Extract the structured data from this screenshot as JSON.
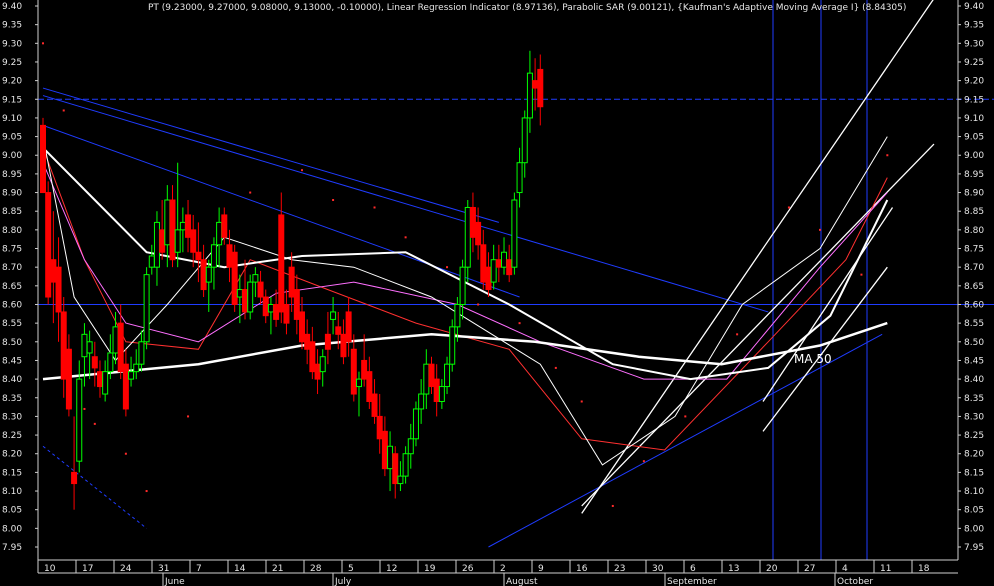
{
  "chart_data": {
    "type": "candlestick",
    "title": "PT (9.23000, 9.27000, 9.08000, 9.13000, -0.10000), Linear Regression Indicator (8.97136), Parabolic SAR (9.00121), {Kaufman's Adaptive Moving Average I} (8.84305)",
    "annotation": "MA 50",
    "ylim": [
      7.95,
      9.42
    ],
    "yticks": [
      "9.40",
      "9.35",
      "9.30",
      "9.25",
      "9.20",
      "9.15",
      "9.10",
      "9.05",
      "9.00",
      "8.95",
      "8.90",
      "8.85",
      "8.80",
      "8.75",
      "8.70",
      "8.65",
      "8.60",
      "8.55",
      "8.50",
      "8.45",
      "8.40",
      "8.35",
      "8.30",
      "8.25",
      "8.20",
      "8.15",
      "8.10",
      "8.05",
      "8.00",
      "7.95"
    ],
    "xticks_top": [
      "10",
      "17",
      "24",
      "31",
      "7",
      "14",
      "21",
      "28",
      "5",
      "12",
      "19",
      "26",
      "2",
      "9",
      "16",
      "23",
      "30",
      "6",
      "13",
      "20",
      "27",
      "4",
      "11",
      "18"
    ],
    "months": [
      "June",
      "July",
      "August",
      "September",
      "October"
    ],
    "horizontal_lines": [
      9.15,
      8.6
    ],
    "colors": {
      "up": "#00ff00",
      "down": "#ff0000",
      "trendline": "#1f3cff",
      "channel": "#ffffff",
      "ma50": "#ffffff",
      "ma_mid": "#ffffff",
      "ma_a": "#ff3030",
      "ma_b": "#ff6fff",
      "sar": "#ff2a2a"
    },
    "candles": [
      {
        "o": 9.08,
        "h": 9.1,
        "l": 8.95,
        "c": 8.9
      },
      {
        "o": 8.9,
        "h": 8.93,
        "l": 8.6,
        "c": 8.62
      },
      {
        "o": 8.72,
        "h": 8.85,
        "l": 8.55,
        "c": 8.66
      },
      {
        "o": 8.7,
        "h": 8.78,
        "l": 8.5,
        "c": 8.58
      },
      {
        "o": 8.58,
        "h": 8.62,
        "l": 8.35,
        "c": 8.4
      },
      {
        "o": 8.48,
        "h": 8.52,
        "l": 8.3,
        "c": 8.32
      },
      {
        "o": 8.15,
        "h": 8.3,
        "l": 8.05,
        "c": 8.12
      },
      {
        "o": 8.18,
        "h": 8.45,
        "l": 8.15,
        "c": 8.4
      },
      {
        "o": 8.46,
        "h": 8.55,
        "l": 8.38,
        "c": 8.52
      },
      {
        "o": 8.47,
        "h": 8.53,
        "l": 8.4,
        "c": 8.5
      },
      {
        "o": 8.46,
        "h": 8.5,
        "l": 8.38,
        "c": 8.43
      },
      {
        "o": 8.42,
        "h": 8.45,
        "l": 8.35,
        "c": 8.38
      },
      {
        "o": 8.36,
        "h": 8.45,
        "l": 8.34,
        "c": 8.42
      },
      {
        "o": 8.42,
        "h": 8.52,
        "l": 8.4,
        "c": 8.47
      },
      {
        "o": 8.47,
        "h": 8.58,
        "l": 8.44,
        "c": 8.54
      },
      {
        "o": 8.55,
        "h": 8.6,
        "l": 8.4,
        "c": 8.42
      },
      {
        "o": 8.44,
        "h": 8.48,
        "l": 8.3,
        "c": 8.32
      },
      {
        "o": 8.4,
        "h": 8.46,
        "l": 8.38,
        "c": 8.42
      },
      {
        "o": 8.42,
        "h": 8.48,
        "l": 8.4,
        "c": 8.44
      },
      {
        "o": 8.44,
        "h": 8.53,
        "l": 8.42,
        "c": 8.5
      },
      {
        "o": 8.5,
        "h": 8.7,
        "l": 8.48,
        "c": 8.68
      },
      {
        "o": 8.7,
        "h": 8.76,
        "l": 8.68,
        "c": 8.73
      },
      {
        "o": 8.7,
        "h": 8.85,
        "l": 8.65,
        "c": 8.82
      },
      {
        "o": 8.8,
        "h": 8.88,
        "l": 8.72,
        "c": 8.74
      },
      {
        "o": 8.76,
        "h": 8.92,
        "l": 8.7,
        "c": 8.88
      },
      {
        "o": 8.88,
        "h": 8.92,
        "l": 8.7,
        "c": 8.72
      },
      {
        "o": 8.74,
        "h": 8.98,
        "l": 8.7,
        "c": 8.8
      },
      {
        "o": 8.8,
        "h": 8.86,
        "l": 8.74,
        "c": 8.82
      },
      {
        "o": 8.84,
        "h": 8.88,
        "l": 8.74,
        "c": 8.78
      },
      {
        "o": 8.8,
        "h": 8.84,
        "l": 8.7,
        "c": 8.74
      },
      {
        "o": 8.74,
        "h": 8.82,
        "l": 8.66,
        "c": 8.72
      },
      {
        "o": 8.72,
        "h": 8.76,
        "l": 8.62,
        "c": 8.64
      },
      {
        "o": 8.66,
        "h": 8.72,
        "l": 8.58,
        "c": 8.7
      },
      {
        "o": 8.7,
        "h": 8.78,
        "l": 8.64,
        "c": 8.76
      },
      {
        "o": 8.76,
        "h": 8.86,
        "l": 8.7,
        "c": 8.82
      },
      {
        "o": 8.84,
        "h": 8.86,
        "l": 8.76,
        "c": 8.78
      },
      {
        "o": 8.76,
        "h": 8.8,
        "l": 8.66,
        "c": 8.7
      },
      {
        "o": 8.74,
        "h": 8.76,
        "l": 8.58,
        "c": 8.6
      },
      {
        "o": 8.62,
        "h": 8.68,
        "l": 8.55,
        "c": 8.64
      },
      {
        "o": 8.64,
        "h": 8.72,
        "l": 8.56,
        "c": 8.58
      },
      {
        "o": 8.58,
        "h": 8.68,
        "l": 8.56,
        "c": 8.66
      },
      {
        "o": 8.66,
        "h": 8.7,
        "l": 8.62,
        "c": 8.68
      },
      {
        "o": 8.66,
        "h": 8.69,
        "l": 8.6,
        "c": 8.62
      },
      {
        "o": 8.62,
        "h": 8.64,
        "l": 8.55,
        "c": 8.57
      },
      {
        "o": 8.58,
        "h": 8.62,
        "l": 8.52,
        "c": 8.6
      },
      {
        "o": 8.6,
        "h": 8.64,
        "l": 8.54,
        "c": 8.56
      },
      {
        "o": 8.84,
        "h": 8.9,
        "l": 8.55,
        "c": 8.58
      },
      {
        "o": 8.6,
        "h": 8.64,
        "l": 8.52,
        "c": 8.55
      },
      {
        "o": 8.7,
        "h": 8.74,
        "l": 8.58,
        "c": 8.62
      },
      {
        "o": 8.64,
        "h": 8.68,
        "l": 8.52,
        "c": 8.56
      },
      {
        "o": 8.58,
        "h": 8.62,
        "l": 8.48,
        "c": 8.5
      },
      {
        "o": 8.52,
        "h": 8.56,
        "l": 8.44,
        "c": 8.48
      },
      {
        "o": 8.5,
        "h": 8.54,
        "l": 8.4,
        "c": 8.42
      },
      {
        "o": 8.44,
        "h": 8.48,
        "l": 8.36,
        "c": 8.4
      },
      {
        "o": 8.42,
        "h": 8.48,
        "l": 8.38,
        "c": 8.46
      },
      {
        "o": 8.52,
        "h": 8.58,
        "l": 8.44,
        "c": 8.48
      },
      {
        "o": 8.56,
        "h": 8.62,
        "l": 8.52,
        "c": 8.58
      },
      {
        "o": 8.54,
        "h": 8.58,
        "l": 8.48,
        "c": 8.52
      },
      {
        "o": 8.52,
        "h": 8.56,
        "l": 8.44,
        "c": 8.46
      },
      {
        "o": 8.58,
        "h": 8.62,
        "l": 8.46,
        "c": 8.5
      },
      {
        "o": 8.48,
        "h": 8.52,
        "l": 8.34,
        "c": 8.36
      },
      {
        "o": 8.38,
        "h": 8.42,
        "l": 8.3,
        "c": 8.4
      },
      {
        "o": 8.45,
        "h": 8.52,
        "l": 8.38,
        "c": 8.4
      },
      {
        "o": 8.42,
        "h": 8.46,
        "l": 8.32,
        "c": 8.34
      },
      {
        "o": 8.36,
        "h": 8.4,
        "l": 8.28,
        "c": 8.3
      },
      {
        "o": 8.3,
        "h": 8.36,
        "l": 8.2,
        "c": 8.24
      },
      {
        "o": 8.26,
        "h": 8.3,
        "l": 8.14,
        "c": 8.16
      },
      {
        "o": 8.16,
        "h": 8.26,
        "l": 8.1,
        "c": 8.22
      },
      {
        "o": 8.2,
        "h": 8.22,
        "l": 8.08,
        "c": 8.12
      },
      {
        "o": 8.12,
        "h": 8.18,
        "l": 8.1,
        "c": 8.14
      },
      {
        "o": 8.14,
        "h": 8.22,
        "l": 8.12,
        "c": 8.2
      },
      {
        "o": 8.2,
        "h": 8.28,
        "l": 8.16,
        "c": 8.24
      },
      {
        "o": 8.24,
        "h": 8.34,
        "l": 8.22,
        "c": 8.32
      },
      {
        "o": 8.32,
        "h": 8.4,
        "l": 8.28,
        "c": 8.36
      },
      {
        "o": 8.36,
        "h": 8.48,
        "l": 8.32,
        "c": 8.44
      },
      {
        "o": 8.44,
        "h": 8.46,
        "l": 8.36,
        "c": 8.38
      },
      {
        "o": 8.4,
        "h": 8.44,
        "l": 8.3,
        "c": 8.34
      },
      {
        "o": 8.34,
        "h": 8.4,
        "l": 8.32,
        "c": 8.38
      },
      {
        "o": 8.38,
        "h": 8.46,
        "l": 8.36,
        "c": 8.44
      },
      {
        "o": 8.44,
        "h": 8.56,
        "l": 8.42,
        "c": 8.54
      },
      {
        "o": 8.54,
        "h": 8.62,
        "l": 8.5,
        "c": 8.6
      },
      {
        "o": 8.6,
        "h": 8.72,
        "l": 8.56,
        "c": 8.7
      },
      {
        "o": 8.7,
        "h": 8.88,
        "l": 8.66,
        "c": 8.86
      },
      {
        "o": 8.86,
        "h": 8.9,
        "l": 8.74,
        "c": 8.78
      },
      {
        "o": 8.82,
        "h": 8.86,
        "l": 8.72,
        "c": 8.76
      },
      {
        "o": 8.76,
        "h": 8.8,
        "l": 8.64,
        "c": 8.66
      },
      {
        "o": 8.7,
        "h": 8.74,
        "l": 8.62,
        "c": 8.64
      },
      {
        "o": 8.66,
        "h": 8.76,
        "l": 8.64,
        "c": 8.72
      },
      {
        "o": 8.72,
        "h": 8.76,
        "l": 8.66,
        "c": 8.7
      },
      {
        "o": 8.7,
        "h": 8.78,
        "l": 8.68,
        "c": 8.74
      },
      {
        "o": 8.72,
        "h": 8.76,
        "l": 8.66,
        "c": 8.68
      },
      {
        "o": 8.7,
        "h": 8.9,
        "l": 8.68,
        "c": 8.88
      },
      {
        "o": 8.9,
        "h": 9.02,
        "l": 8.86,
        "c": 8.98
      },
      {
        "o": 8.98,
        "h": 9.12,
        "l": 8.94,
        "c": 9.1
      },
      {
        "o": 9.1,
        "h": 9.28,
        "l": 9.06,
        "c": 9.22
      },
      {
        "o": 9.2,
        "h": 9.26,
        "l": 9.12,
        "c": 9.18
      },
      {
        "o": 9.23,
        "h": 9.27,
        "l": 9.08,
        "c": 9.13
      }
    ],
    "trend_lines": [
      {
        "x1": 0,
        "y1": 9.18,
        "x2": 88,
        "y2": 8.82
      },
      {
        "x1": 0,
        "y1": 9.16,
        "x2": 140,
        "y2": 8.58
      },
      {
        "x1": 0,
        "y1": 9.08,
        "x2": 92,
        "y2": 8.62
      },
      {
        "x1": 0,
        "y1": 8.22,
        "x2": 20,
        "y2": 8.0
      },
      {
        "x1": 86,
        "y1": 7.95,
        "x2": 162,
        "y2": 8.52
      }
    ],
    "channel_lines": [
      {
        "x1": 104,
        "y1": 8.04,
        "x2": 172,
        "y2": 9.42
      },
      {
        "x1": 104,
        "y1": 8.06,
        "x2": 172,
        "y2": 9.03
      },
      {
        "x1": 139,
        "y1": 8.26,
        "x2": 163,
        "y2": 8.7
      },
      {
        "x1": 139,
        "y1": 8.34,
        "x2": 164,
        "y2": 8.86
      }
    ],
    "indicators": {
      "ma50": [
        [
          0,
          8.4
        ],
        [
          30,
          8.44
        ],
        [
          50,
          8.49
        ],
        [
          75,
          8.52
        ],
        [
          95,
          8.5
        ],
        [
          115,
          8.46
        ],
        [
          131,
          8.44
        ],
        [
          150,
          8.49
        ],
        [
          163,
          8.55
        ]
      ],
      "ma_mid": [
        [
          0,
          9.02
        ],
        [
          10,
          8.88
        ],
        [
          20,
          8.74
        ],
        [
          35,
          8.7
        ],
        [
          50,
          8.73
        ],
        [
          70,
          8.74
        ],
        [
          90,
          8.6
        ],
        [
          110,
          8.44
        ],
        [
          125,
          8.4
        ],
        [
          140,
          8.43
        ],
        [
          152,
          8.57
        ],
        [
          163,
          8.88
        ]
      ],
      "ma_a": [
        [
          0,
          9.02
        ],
        [
          8,
          8.72
        ],
        [
          16,
          8.5
        ],
        [
          30,
          8.48
        ],
        [
          40,
          8.72
        ],
        [
          55,
          8.64
        ],
        [
          72,
          8.55
        ],
        [
          90,
          8.48
        ],
        [
          104,
          8.24
        ],
        [
          120,
          8.21
        ],
        [
          140,
          8.5
        ],
        [
          155,
          8.72
        ],
        [
          163,
          8.94
        ]
      ],
      "ma_b": [
        [
          0,
          8.98
        ],
        [
          8,
          8.72
        ],
        [
          16,
          8.55
        ],
        [
          30,
          8.5
        ],
        [
          45,
          8.63
        ],
        [
          60,
          8.66
        ],
        [
          80,
          8.6
        ],
        [
          96,
          8.5
        ],
        [
          116,
          8.4
        ],
        [
          132,
          8.4
        ],
        [
          150,
          8.7
        ],
        [
          163,
          8.9
        ]
      ],
      "ema_fast": [
        [
          0,
          9.05
        ],
        [
          6,
          8.62
        ],
        [
          14,
          8.45
        ],
        [
          24,
          8.6
        ],
        [
          35,
          8.78
        ],
        [
          48,
          8.72
        ],
        [
          60,
          8.7
        ],
        [
          75,
          8.62
        ],
        [
          96,
          8.44
        ],
        [
          108,
          8.17
        ],
        [
          122,
          8.3
        ],
        [
          135,
          8.6
        ],
        [
          150,
          8.75
        ],
        [
          163,
          9.05
        ]
      ],
      "sar": [
        [
          0,
          9.3
        ],
        [
          4,
          9.12
        ],
        [
          8,
          8.32
        ],
        [
          10,
          8.28
        ],
        [
          16,
          8.2
        ],
        [
          20,
          8.1
        ],
        [
          28,
          8.3
        ],
        [
          40,
          8.9
        ],
        [
          50,
          8.96
        ],
        [
          56,
          8.88
        ],
        [
          64,
          8.86
        ],
        [
          70,
          8.78
        ],
        [
          78,
          8.7
        ],
        [
          84,
          8.6
        ],
        [
          92,
          8.55
        ],
        [
          99,
          8.43
        ],
        [
          104,
          8.34
        ],
        [
          110,
          8.06
        ],
        [
          116,
          8.18
        ],
        [
          124,
          8.3
        ],
        [
          134,
          8.52
        ],
        [
          144,
          8.86
        ],
        [
          150,
          8.8
        ],
        [
          158,
          8.68
        ],
        [
          163,
          9.0
        ]
      ]
    }
  }
}
